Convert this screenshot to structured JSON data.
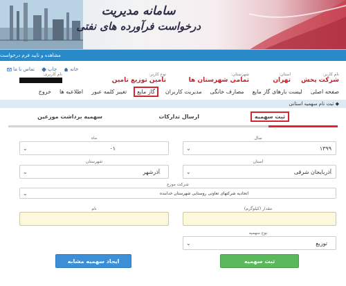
{
  "banner": {
    "title_line1": "سامانه مدیریت",
    "title_line2": "درخواست فرآورده های نفتی"
  },
  "breadcrumb": "مشاهده و تایید فرم درخواست",
  "topnav": {
    "home": "خانه",
    "print": "چاپ",
    "contact": "تماس با ما"
  },
  "info": {
    "username_label": "نام کاربر:",
    "username": "شرکت پخش",
    "province_label": "استان:",
    "province": "تهران",
    "city_label": "شهرستان:",
    "city": "تمامي شهرستان ها",
    "usertype_label": "نوع کاربر:",
    "usertype": "تامين توزيع تامين",
    "login_label": "نام کاربری:"
  },
  "menu": {
    "items": [
      {
        "label": "صفحه اصلی",
        "active": false
      },
      {
        "label": "لیست بارهای گاز مایع",
        "active": false
      },
      {
        "label": "مصارف خانگی",
        "active": false
      },
      {
        "label": "مدیریت کاربران",
        "active": false
      },
      {
        "label": "گاز مایع",
        "active": true
      },
      {
        "label": "تغییر کلمه عبور",
        "active": false
      },
      {
        "label": "اطلاعیه ها",
        "active": false
      },
      {
        "label": "خروج",
        "active": false
      }
    ]
  },
  "section_title": "ثبت نام سهمیه استانی",
  "tabs": {
    "register": "ثبت سهمیه",
    "send": "ارسال تدارکات",
    "distributor": "سهمیه برداشت موزعین"
  },
  "form": {
    "year_label": "سال",
    "year_value": "۱۳۹۹",
    "month_label": "ماه",
    "month_value": "۰۱",
    "province_label": "استان",
    "province_value": "آذربایجان شرقی",
    "city_label": "شهرستان",
    "city_value": "آذرشهر",
    "distributor_label": "شرکت موزع",
    "distributor_value": "اتحادیه شرکتهای تعاونی روستایی شهرستان خدابنده",
    "amount_label": "مقدار (کیلوگرم)",
    "amount_value": "",
    "name_label": "نام",
    "name_value": "",
    "type_label": "نوع سهمیه",
    "type_value": "توزیع",
    "submit_label": "ثبت سهمیه",
    "similar_label": "ایجاد سهمیه مشابه"
  },
  "colors": {
    "accent_red": "#d3262c",
    "bar_blue": "#2a89c9",
    "button_green": "#5cb85c",
    "button_blue": "#3c8fd6",
    "input_yellow": "#fcf8dc"
  }
}
